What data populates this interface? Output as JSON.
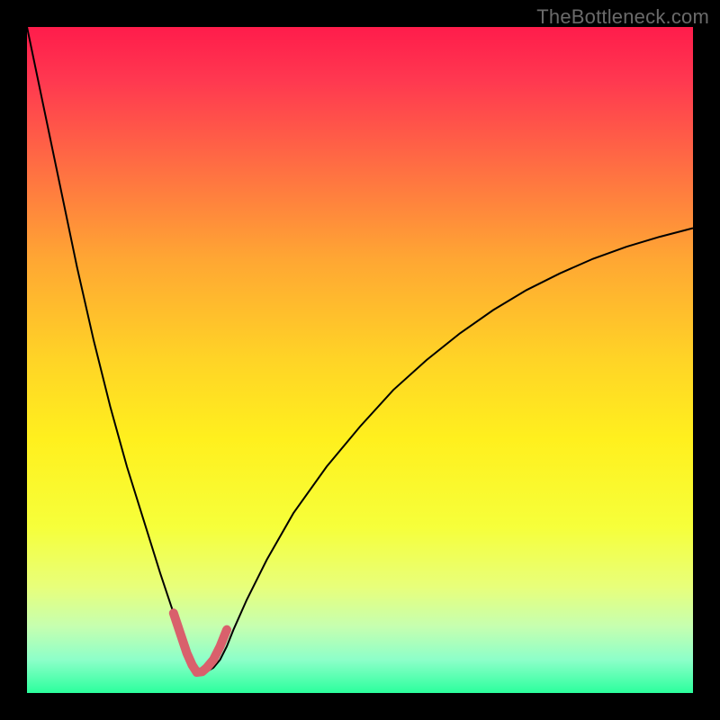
{
  "watermark": "TheBottleneck.com",
  "chart_data": {
    "type": "line",
    "title": "",
    "xlabel": "",
    "ylabel": "",
    "xlim": [
      0,
      100
    ],
    "ylim": [
      0,
      100
    ],
    "grid": false,
    "legend": false,
    "background": {
      "gradient_stops": [
        {
          "pct": 0,
          "color": "#ff1c4b"
        },
        {
          "pct": 8,
          "color": "#ff3850"
        },
        {
          "pct": 20,
          "color": "#ff6a44"
        },
        {
          "pct": 35,
          "color": "#ffa733"
        },
        {
          "pct": 50,
          "color": "#ffd426"
        },
        {
          "pct": 62,
          "color": "#fff01e"
        },
        {
          "pct": 75,
          "color": "#f6ff3a"
        },
        {
          "pct": 84,
          "color": "#e8ff7a"
        },
        {
          "pct": 90,
          "color": "#c6ffb0"
        },
        {
          "pct": 95,
          "color": "#8dffc9"
        },
        {
          "pct": 100,
          "color": "#2bff9d"
        }
      ]
    },
    "series": [
      {
        "name": "bottleneck-curve",
        "color": "#000000",
        "width": 2,
        "x": [
          0.0,
          2.5,
          5.0,
          7.5,
          10.0,
          12.5,
          15.0,
          17.5,
          20.0,
          22.0,
          23.5,
          24.5,
          25.0,
          25.5,
          26.0,
          27.0,
          28.0,
          29.0,
          30.0,
          31.0,
          33.0,
          36.0,
          40.0,
          45.0,
          50.0,
          55.0,
          60.0,
          65.0,
          70.0,
          75.0,
          80.0,
          85.0,
          90.0,
          95.0,
          100.0
        ],
        "y": [
          100.0,
          88.0,
          76.0,
          64.0,
          53.0,
          43.0,
          34.0,
          26.0,
          18.0,
          12.0,
          8.0,
          5.0,
          3.7,
          3.1,
          3.0,
          3.2,
          3.8,
          5.0,
          7.0,
          9.5,
          14.0,
          20.0,
          27.0,
          34.0,
          40.0,
          45.5,
          50.0,
          54.0,
          57.5,
          60.5,
          63.0,
          65.2,
          67.0,
          68.5,
          69.8
        ]
      },
      {
        "name": "optimal-zone",
        "color": "#d9606c",
        "width": 10,
        "linecap": "round",
        "x": [
          22.0,
          23.0,
          24.0,
          24.8,
          25.5,
          26.3,
          27.0,
          28.0,
          29.0,
          30.0
        ],
        "y": [
          12.0,
          9.0,
          6.0,
          4.2,
          3.1,
          3.2,
          3.8,
          5.0,
          7.0,
          9.5
        ]
      }
    ]
  }
}
